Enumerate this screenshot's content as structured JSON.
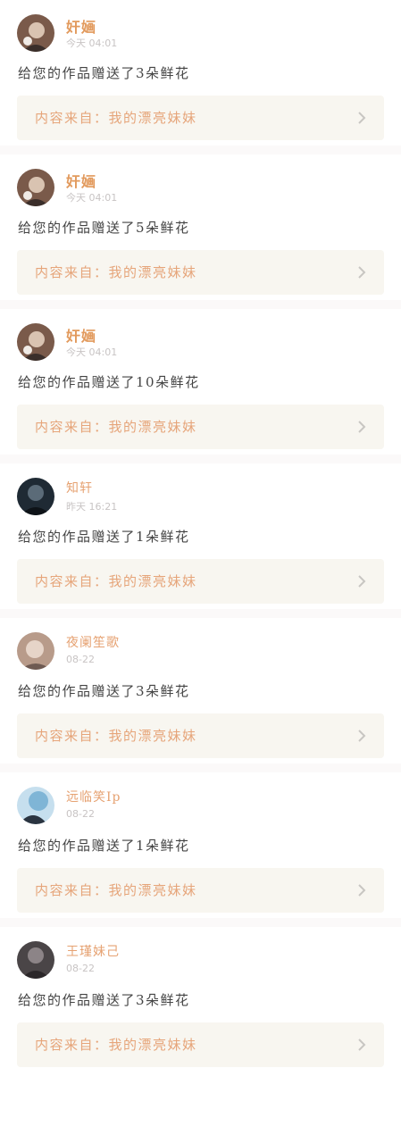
{
  "cards": [
    {
      "user": "奸婳",
      "time": "今天 04:01",
      "message": "给您的作品赠送了3朵鲜花",
      "source": "内容来自：我的漂亮妹妹",
      "avatar_colors": [
        "#7a5a4a",
        "#d9c3b1",
        "#3a2e2a"
      ]
    },
    {
      "user": "奸婳",
      "time": "今天 04:01",
      "message": "给您的作品赠送了5朵鲜花",
      "source": "内容来自：我的漂亮妹妹",
      "avatar_colors": [
        "#7a5a4a",
        "#d9c3b1",
        "#3a2e2a"
      ]
    },
    {
      "user": "奸婳",
      "time": "今天 04:01",
      "message": "给您的作品赠送了10朵鲜花",
      "source": "内容来自：我的漂亮妹妹",
      "avatar_colors": [
        "#7a5a4a",
        "#d9c3b1",
        "#3a2e2a"
      ]
    },
    {
      "user": "知轩",
      "time": "昨天 16:21",
      "message": "给您的作品赠送了1朵鲜花",
      "source": "内容来自：我的漂亮妹妹",
      "avatar_colors": [
        "#1f2a34",
        "#5b6b78",
        "#0e1318"
      ]
    },
    {
      "user": "夜阑笙歌",
      "time": "08-22",
      "message": "给您的作品赠送了3朵鲜花",
      "source": "内容来自：我的漂亮妹妹",
      "avatar_colors": [
        "#b89b8a",
        "#e6d4c8",
        "#6e5a52"
      ]
    },
    {
      "user": "远临笑Ip",
      "time": "08-22",
      "message": "给您的作品赠送了1朵鲜花",
      "source": "内容来自：我的漂亮妹妹",
      "avatar_colors": [
        "#7fb5d6",
        "#2a3440",
        "#c6dfee"
      ]
    },
    {
      "user": "王瑾妹己",
      "time": "08-22",
      "message": "给您的作品赠送了3朵鲜花",
      "source": "内容来自：我的漂亮妹妹",
      "avatar_colors": [
        "#4a4547",
        "#8c8487",
        "#2b2729"
      ]
    }
  ],
  "icons": {
    "avatar": "user-avatar",
    "chevron": "chevron-right-icon"
  },
  "colors": {
    "accent": "#e29a5d",
    "source_bg": "#f8f6f0",
    "divider": "#fbf9f9"
  }
}
